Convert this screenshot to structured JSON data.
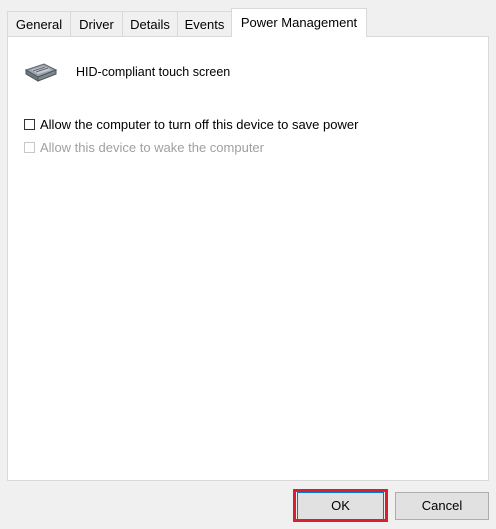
{
  "tabs": [
    {
      "label": "General",
      "active": false
    },
    {
      "label": "Driver",
      "active": false
    },
    {
      "label": "Details",
      "active": false
    },
    {
      "label": "Events",
      "active": false
    },
    {
      "label": "Power Management",
      "active": true
    }
  ],
  "device": {
    "icon": "touch-screen-device-icon",
    "name": "HID-compliant touch screen"
  },
  "options": [
    {
      "label": "Allow the computer to turn off this device to save power",
      "checked": false,
      "enabled": true,
      "highlighted": true
    },
    {
      "label": "Allow this device to wake the computer",
      "checked": false,
      "enabled": false,
      "highlighted": false
    }
  ],
  "buttons": {
    "ok_label": "OK",
    "cancel_label": "Cancel"
  },
  "colors": {
    "highlight": "#d9202e",
    "panel_bg": "#ffffff",
    "window_bg": "#f0f0f0"
  }
}
